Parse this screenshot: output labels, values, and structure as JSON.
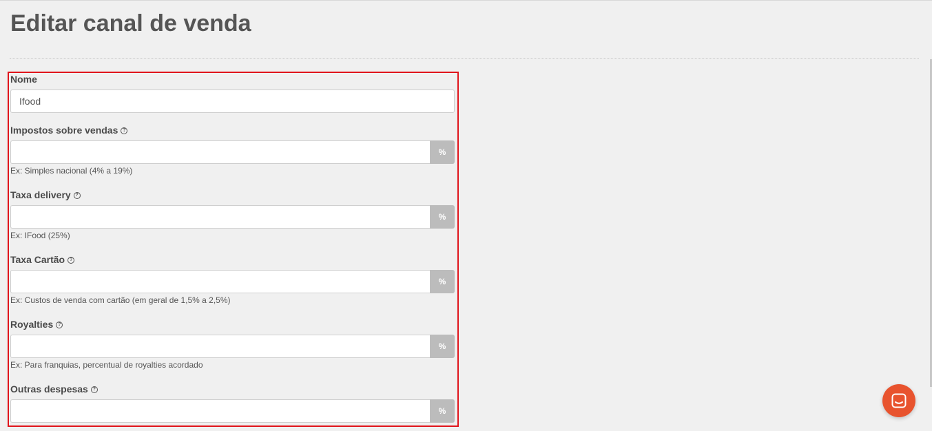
{
  "page": {
    "title": "Editar canal de venda"
  },
  "form": {
    "nome": {
      "label": "Nome",
      "value": "Ifood"
    },
    "impostos": {
      "label": "Impostos sobre vendas",
      "value": "",
      "addon": "%",
      "hint": "Ex: Simples nacional (4% a 19%)"
    },
    "taxa_delivery": {
      "label": "Taxa delivery",
      "value": "",
      "addon": "%",
      "hint": "Ex: IFood (25%)"
    },
    "taxa_cartao": {
      "label": "Taxa Cartão",
      "value": "",
      "addon": "%",
      "hint": "Ex: Custos de venda com cartão (em geral de 1,5% a 2,5%)"
    },
    "royalties": {
      "label": "Royalties",
      "value": "",
      "addon": "%",
      "hint": "Ex: Para franquias, percentual de royalties acordado"
    },
    "outras_despesas": {
      "label": "Outras despesas",
      "value": "",
      "addon": "%"
    }
  },
  "icons": {
    "help": "question-circle-icon",
    "chat": "chat-icon"
  },
  "colors": {
    "highlight": "#e0141b",
    "chat_button": "#e8532e",
    "addon_bg": "#bcbcbc"
  }
}
